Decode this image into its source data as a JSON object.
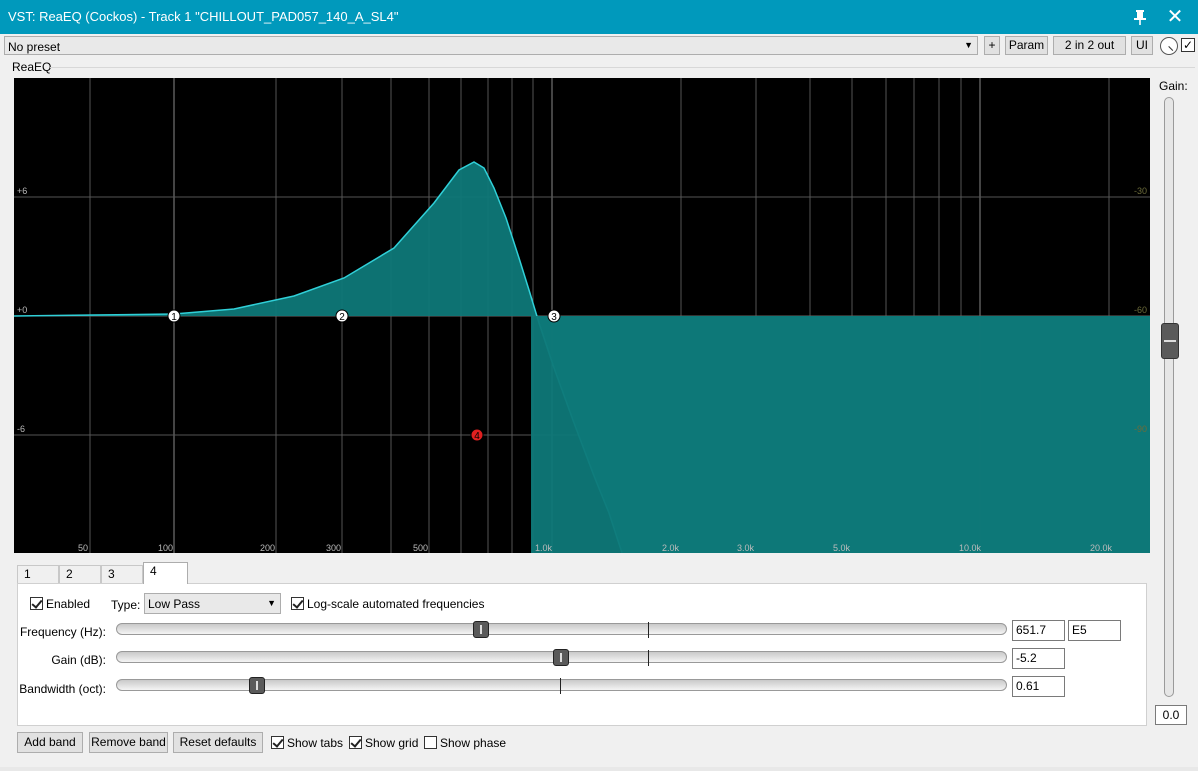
{
  "window": {
    "title": "VST: ReaEQ (Cockos) - Track 1 \"CHILLOUT_PAD057_140_A_SL4\"",
    "close_glyph": "✕",
    "pin_icon": "pin-icon"
  },
  "toolbar": {
    "preset_value": "No preset",
    "add_preset_label": "+",
    "param_label": "Param",
    "io_label": "2 in 2 out",
    "ui_label": "UI",
    "knob_icon": "wet-knob-icon",
    "bypass_checked": true
  },
  "plugin": {
    "name": "ReaEQ"
  },
  "graph": {
    "db_left_labels": [
      "+6",
      "+0",
      "-6"
    ],
    "db_right_labels": [
      "-30",
      "-60",
      "-90"
    ],
    "freq_labels": [
      "50",
      "100",
      "200",
      "300",
      "500",
      "1.0k",
      "2.0k",
      "3.0k",
      "5.0k",
      "10.0k",
      "20.0k"
    ],
    "band_nodes": [
      "1",
      "2",
      "3",
      "4"
    ],
    "selected_band": "4",
    "colors": {
      "background": "#000000",
      "curve": "#30d0d8",
      "fill": "#0e7878",
      "selected_node": "#e02020",
      "node": "#ffffff"
    }
  },
  "gain": {
    "label": "Gain:",
    "value": "0.0"
  },
  "tabs": [
    {
      "label": "1",
      "active": false
    },
    {
      "label": "2",
      "active": false
    },
    {
      "label": "3",
      "active": false
    },
    {
      "label": "4",
      "active": true
    }
  ],
  "band": {
    "enabled_label": "Enabled",
    "enabled": true,
    "type_label": "Type:",
    "type_value": "Low Pass",
    "logscale_label": "Log-scale automated frequencies",
    "logscale": true,
    "frequency": {
      "label": "Frequency (Hz):",
      "value": "651.7",
      "note": "E5"
    },
    "gain": {
      "label": "Gain (dB):",
      "value": "-5.2"
    },
    "bandwidth": {
      "label": "Bandwidth (oct):",
      "value": "0.61"
    }
  },
  "bottom": {
    "add_band": "Add band",
    "remove_band": "Remove band",
    "reset_defaults": "Reset defaults",
    "show_tabs_label": "Show tabs",
    "show_tabs": true,
    "show_grid_label": "Show grid",
    "show_grid": true,
    "show_phase_label": "Show phase",
    "show_phase": false
  }
}
